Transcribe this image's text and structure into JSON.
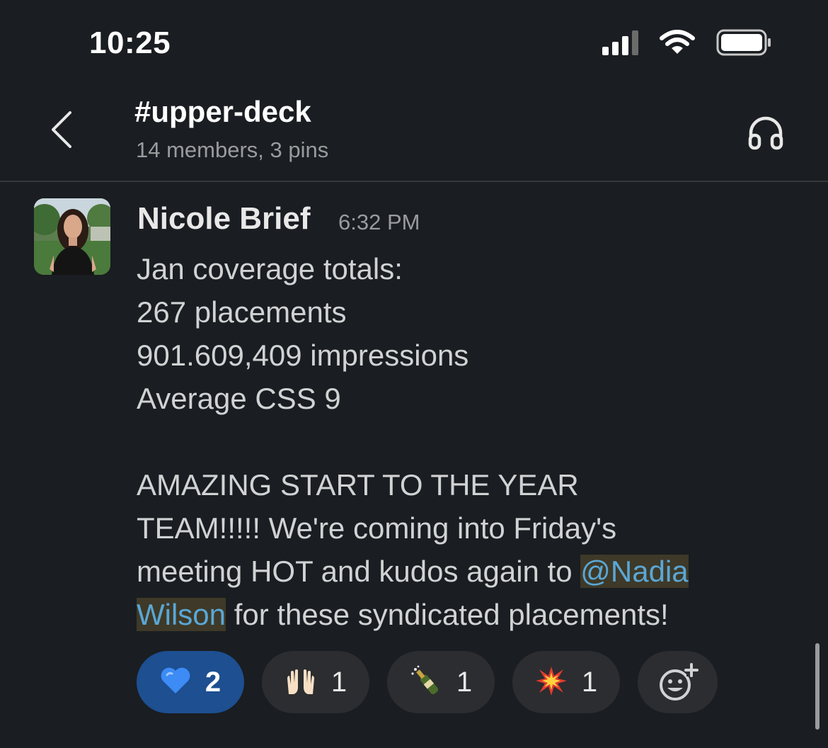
{
  "status_bar": {
    "time": "10:25",
    "icons": [
      "cellular-signal-icon",
      "wifi-icon",
      "battery-icon"
    ]
  },
  "header": {
    "channel_name": "#upper-deck",
    "meta": "14 members, 3 pins",
    "icons": {
      "back": "chevron-left-icon",
      "huddle": "headphones-icon"
    }
  },
  "message": {
    "sender": "Nicole Brief",
    "timestamp": "6:32 PM",
    "lines": {
      "l1": "Jan coverage totals:",
      "l2": "267 placements",
      "l3": "901.609,409 impressions",
      "l4": "Average CSS 9",
      "l5": "AMAZING START TO THE YEAR",
      "l6": "TEAM!!!!! We're coming into Friday's",
      "l7_pre": "meeting HOT and kudos again to ",
      "mention_part1": "@Nadia",
      "mention_part2": "Wilson",
      "l8_post": " for these syndicated placements!"
    }
  },
  "reactions": [
    {
      "emoji": "💙",
      "count": "2",
      "selected": true
    },
    {
      "emoji": "🙌",
      "count": "1",
      "selected": false
    },
    {
      "emoji": "🍾",
      "count": "1",
      "selected": false
    },
    {
      "emoji": "💥",
      "count": "1",
      "selected": false
    }
  ],
  "add_reaction_icon": "add-reaction-icon",
  "colors": {
    "background": "#1a1d21",
    "selected_reaction": "#1d4f91",
    "mention": "#5aa7d6"
  }
}
